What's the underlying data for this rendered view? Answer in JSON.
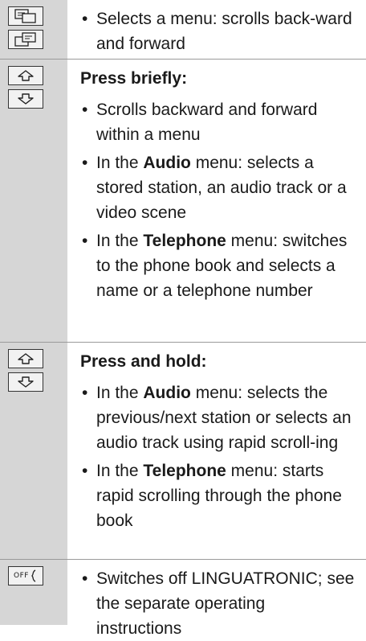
{
  "rows": [
    {
      "icons": [
        "page-back-icon",
        "page-forward-icon"
      ],
      "items": [
        {
          "text": "Selects a menu: scrolls back-ward and forward"
        }
      ]
    },
    {
      "icons": [
        "arrow-up-icon",
        "arrow-down-icon"
      ],
      "heading": "Press briefly:",
      "items": [
        {
          "text": "Scrolls backward and forward within a menu"
        },
        {
          "pre": "In the ",
          "bold": "Audio",
          "post": " menu: selects a stored station, an audio track or a video scene"
        },
        {
          "pre": "In the ",
          "bold": "Telephone",
          "post": " menu: switches to the phone book and selects a name or a telephone number"
        }
      ]
    },
    {
      "icons": [
        "arrow-up-icon",
        "arrow-down-icon"
      ],
      "heading": "Press and hold:",
      "items": [
        {
          "pre": "In the ",
          "bold": "Audio",
          "post": " menu: selects the previous/next station or selects an audio track using rapid scroll-ing"
        },
        {
          "pre": "In the ",
          "bold": "Telephone",
          "post": " menu: starts rapid scrolling through the phone book"
        }
      ]
    },
    {
      "icons": [
        "voice-off-icon"
      ],
      "icon_label": "OFF",
      "items": [
        {
          "text": "Switches off LINGUATRONIC; see the separate operating instructions"
        }
      ]
    }
  ]
}
